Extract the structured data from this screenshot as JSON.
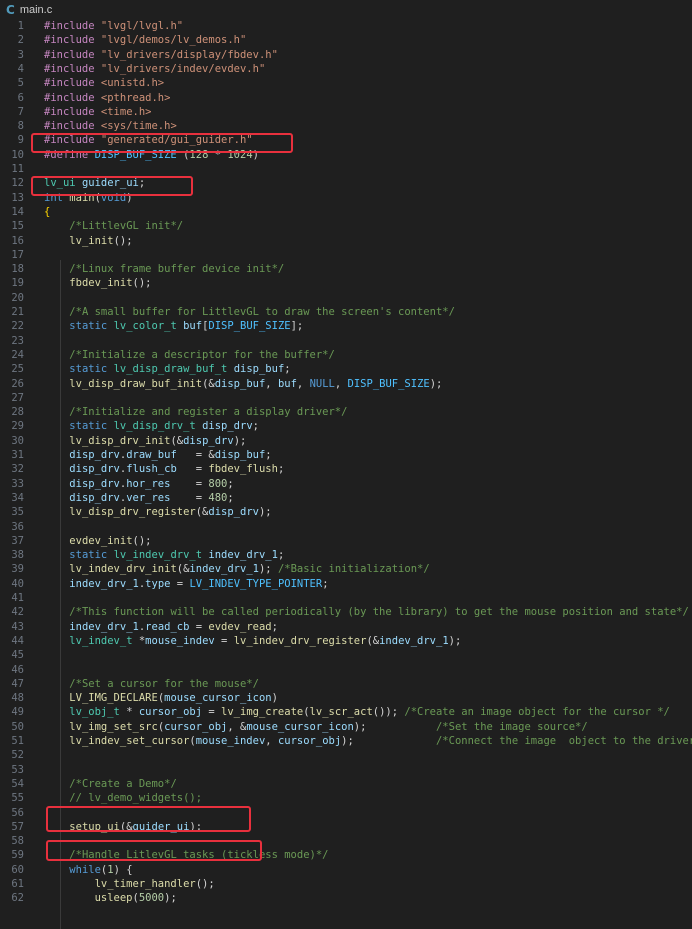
{
  "tab": {
    "icon": "C",
    "filename": "main.c"
  },
  "code": [
    {
      "n": "1",
      "t": [
        [
          "pp",
          "#include "
        ],
        [
          "str",
          "\"lvgl/lvgl.h\""
        ]
      ]
    },
    {
      "n": "2",
      "t": [
        [
          "pp",
          "#include "
        ],
        [
          "str",
          "\"lvgl/demos/lv_demos.h\""
        ]
      ]
    },
    {
      "n": "3",
      "t": [
        [
          "pp",
          "#include "
        ],
        [
          "str",
          "\"lv_drivers/display/fbdev.h\""
        ]
      ]
    },
    {
      "n": "4",
      "t": [
        [
          "pp",
          "#include "
        ],
        [
          "str",
          "\"lv_drivers/indev/evdev.h\""
        ]
      ]
    },
    {
      "n": "5",
      "t": [
        [
          "pp",
          "#include "
        ],
        [
          "str",
          "<unistd.h>"
        ]
      ]
    },
    {
      "n": "6",
      "t": [
        [
          "pp",
          "#include "
        ],
        [
          "str",
          "<pthread.h>"
        ]
      ]
    },
    {
      "n": "7",
      "t": [
        [
          "pp",
          "#include "
        ],
        [
          "str",
          "<time.h>"
        ]
      ]
    },
    {
      "n": "8",
      "t": [
        [
          "pp",
          "#include "
        ],
        [
          "str",
          "<sys/time.h>"
        ]
      ]
    },
    {
      "n": "9",
      "t": [
        [
          "pp",
          "#include "
        ],
        [
          "str",
          "\"generated/gui_guider.h\""
        ]
      ]
    },
    {
      "n": "10",
      "t": [
        [
          "pp",
          "#define "
        ],
        [
          "mc",
          "DISP_BUF_SIZE"
        ],
        [
          "pl",
          " ("
        ],
        [
          "nm",
          "128"
        ],
        [
          "pl",
          " * "
        ],
        [
          "nm",
          "1024"
        ],
        [
          "pl",
          ")"
        ]
      ]
    },
    {
      "n": "11",
      "t": []
    },
    {
      "n": "12",
      "t": [
        [
          "ty",
          "lv_ui"
        ],
        [
          "pl",
          " "
        ],
        [
          "vr",
          "guider_ui"
        ],
        [
          "pl",
          ";"
        ]
      ]
    },
    {
      "n": "13",
      "t": [
        [
          "kw",
          "int"
        ],
        [
          "pl",
          " "
        ],
        [
          "fn",
          "main"
        ],
        [
          "pl",
          "("
        ],
        [
          "kw",
          "void"
        ],
        [
          "pl",
          ")"
        ]
      ]
    },
    {
      "n": "14",
      "t": [
        [
          "br",
          "{"
        ]
      ]
    },
    {
      "n": "15",
      "t": [
        [
          "pl",
          "    "
        ],
        [
          "cm",
          "/*LittlevGL init*/"
        ]
      ]
    },
    {
      "n": "16",
      "t": [
        [
          "pl",
          "    "
        ],
        [
          "fn",
          "lv_init"
        ],
        [
          "pl",
          "();"
        ]
      ]
    },
    {
      "n": "17",
      "t": []
    },
    {
      "n": "18",
      "t": [
        [
          "pl",
          "    "
        ],
        [
          "cm",
          "/*Linux frame buffer device init*/"
        ]
      ]
    },
    {
      "n": "19",
      "t": [
        [
          "pl",
          "    "
        ],
        [
          "fn",
          "fbdev_init"
        ],
        [
          "pl",
          "();"
        ]
      ]
    },
    {
      "n": "20",
      "t": []
    },
    {
      "n": "21",
      "t": [
        [
          "pl",
          "    "
        ],
        [
          "cm",
          "/*A small buffer for LittlevGL to draw the screen's content*/"
        ]
      ]
    },
    {
      "n": "22",
      "t": [
        [
          "pl",
          "    "
        ],
        [
          "kw",
          "static"
        ],
        [
          "pl",
          " "
        ],
        [
          "ty",
          "lv_color_t"
        ],
        [
          "pl",
          " "
        ],
        [
          "vr",
          "buf"
        ],
        [
          "pl",
          "["
        ],
        [
          "mc",
          "DISP_BUF_SIZE"
        ],
        [
          "pl",
          "];"
        ]
      ]
    },
    {
      "n": "23",
      "t": []
    },
    {
      "n": "24",
      "t": [
        [
          "pl",
          "    "
        ],
        [
          "cm",
          "/*Initialize a descriptor for the buffer*/"
        ]
      ]
    },
    {
      "n": "25",
      "t": [
        [
          "pl",
          "    "
        ],
        [
          "kw",
          "static"
        ],
        [
          "pl",
          " "
        ],
        [
          "ty",
          "lv_disp_draw_buf_t"
        ],
        [
          "pl",
          " "
        ],
        [
          "vr",
          "disp_buf"
        ],
        [
          "pl",
          ";"
        ]
      ]
    },
    {
      "n": "26",
      "t": [
        [
          "pl",
          "    "
        ],
        [
          "fn",
          "lv_disp_draw_buf_init"
        ],
        [
          "pl",
          "(&"
        ],
        [
          "vr",
          "disp_buf"
        ],
        [
          "pl",
          ", "
        ],
        [
          "vr",
          "buf"
        ],
        [
          "pl",
          ", "
        ],
        [
          "kw",
          "NULL"
        ],
        [
          "pl",
          ", "
        ],
        [
          "mc",
          "DISP_BUF_SIZE"
        ],
        [
          "pl",
          ");"
        ]
      ]
    },
    {
      "n": "27",
      "t": []
    },
    {
      "n": "28",
      "t": [
        [
          "pl",
          "    "
        ],
        [
          "cm",
          "/*Initialize and register a display driver*/"
        ]
      ]
    },
    {
      "n": "29",
      "t": [
        [
          "pl",
          "    "
        ],
        [
          "kw",
          "static"
        ],
        [
          "pl",
          " "
        ],
        [
          "ty",
          "lv_disp_drv_t"
        ],
        [
          "pl",
          " "
        ],
        [
          "vr",
          "disp_drv"
        ],
        [
          "pl",
          ";"
        ]
      ]
    },
    {
      "n": "30",
      "t": [
        [
          "pl",
          "    "
        ],
        [
          "fn",
          "lv_disp_drv_init"
        ],
        [
          "pl",
          "(&"
        ],
        [
          "vr",
          "disp_drv"
        ],
        [
          "pl",
          ");"
        ]
      ]
    },
    {
      "n": "31",
      "t": [
        [
          "pl",
          "    "
        ],
        [
          "vr",
          "disp_drv"
        ],
        [
          "pl",
          "."
        ],
        [
          "vr",
          "draw_buf"
        ],
        [
          "pl",
          "   = &"
        ],
        [
          "vr",
          "disp_buf"
        ],
        [
          "pl",
          ";"
        ]
      ]
    },
    {
      "n": "32",
      "t": [
        [
          "pl",
          "    "
        ],
        [
          "vr",
          "disp_drv"
        ],
        [
          "pl",
          "."
        ],
        [
          "vr",
          "flush_cb"
        ],
        [
          "pl",
          "   = "
        ],
        [
          "fn",
          "fbdev_flush"
        ],
        [
          "pl",
          ";"
        ]
      ]
    },
    {
      "n": "33",
      "t": [
        [
          "pl",
          "    "
        ],
        [
          "vr",
          "disp_drv"
        ],
        [
          "pl",
          "."
        ],
        [
          "vr",
          "hor_res"
        ],
        [
          "pl",
          "    = "
        ],
        [
          "nm",
          "800"
        ],
        [
          "pl",
          ";"
        ]
      ]
    },
    {
      "n": "34",
      "t": [
        [
          "pl",
          "    "
        ],
        [
          "vr",
          "disp_drv"
        ],
        [
          "pl",
          "."
        ],
        [
          "vr",
          "ver_res"
        ],
        [
          "pl",
          "    = "
        ],
        [
          "nm",
          "480"
        ],
        [
          "pl",
          ";"
        ]
      ]
    },
    {
      "n": "35",
      "t": [
        [
          "pl",
          "    "
        ],
        [
          "fn",
          "lv_disp_drv_register"
        ],
        [
          "pl",
          "(&"
        ],
        [
          "vr",
          "disp_drv"
        ],
        [
          "pl",
          ");"
        ]
      ]
    },
    {
      "n": "36",
      "t": []
    },
    {
      "n": "37",
      "t": [
        [
          "pl",
          "    "
        ],
        [
          "fn",
          "evdev_init"
        ],
        [
          "pl",
          "();"
        ]
      ]
    },
    {
      "n": "38",
      "t": [
        [
          "pl",
          "    "
        ],
        [
          "kw",
          "static"
        ],
        [
          "pl",
          " "
        ],
        [
          "ty",
          "lv_indev_drv_t"
        ],
        [
          "pl",
          " "
        ],
        [
          "vr",
          "indev_drv_1"
        ],
        [
          "pl",
          ";"
        ]
      ]
    },
    {
      "n": "39",
      "t": [
        [
          "pl",
          "    "
        ],
        [
          "fn",
          "lv_indev_drv_init"
        ],
        [
          "pl",
          "(&"
        ],
        [
          "vr",
          "indev_drv_1"
        ],
        [
          "pl",
          "); "
        ],
        [
          "cm",
          "/*Basic initialization*/"
        ]
      ]
    },
    {
      "n": "40",
      "t": [
        [
          "pl",
          "    "
        ],
        [
          "vr",
          "indev_drv_1"
        ],
        [
          "pl",
          "."
        ],
        [
          "vr",
          "type"
        ],
        [
          "pl",
          " = "
        ],
        [
          "mc",
          "LV_INDEV_TYPE_POINTER"
        ],
        [
          "pl",
          ";"
        ]
      ]
    },
    {
      "n": "41",
      "t": []
    },
    {
      "n": "42",
      "t": [
        [
          "pl",
          "    "
        ],
        [
          "cm",
          "/*This function will be called periodically (by the library) to get the mouse position and state*/"
        ]
      ]
    },
    {
      "n": "43",
      "t": [
        [
          "pl",
          "    "
        ],
        [
          "vr",
          "indev_drv_1"
        ],
        [
          "pl",
          "."
        ],
        [
          "vr",
          "read_cb"
        ],
        [
          "pl",
          " = "
        ],
        [
          "fn",
          "evdev_read"
        ],
        [
          "pl",
          ";"
        ]
      ]
    },
    {
      "n": "44",
      "t": [
        [
          "pl",
          "    "
        ],
        [
          "ty",
          "lv_indev_t"
        ],
        [
          "pl",
          " *"
        ],
        [
          "vr",
          "mouse_indev"
        ],
        [
          "pl",
          " = "
        ],
        [
          "fn",
          "lv_indev_drv_register"
        ],
        [
          "pl",
          "(&"
        ],
        [
          "vr",
          "indev_drv_1"
        ],
        [
          "pl",
          ");"
        ]
      ]
    },
    {
      "n": "45",
      "t": []
    },
    {
      "n": "46",
      "t": []
    },
    {
      "n": "47",
      "t": [
        [
          "pl",
          "    "
        ],
        [
          "cm",
          "/*Set a cursor for the mouse*/"
        ]
      ]
    },
    {
      "n": "48",
      "t": [
        [
          "pl",
          "    "
        ],
        [
          "fn",
          "LV_IMG_DECLARE"
        ],
        [
          "pl",
          "("
        ],
        [
          "vr",
          "mouse_cursor_icon"
        ],
        [
          "pl",
          ")"
        ]
      ]
    },
    {
      "n": "49",
      "t": [
        [
          "pl",
          "    "
        ],
        [
          "ty",
          "lv_obj_t"
        ],
        [
          "pl",
          " * "
        ],
        [
          "vr",
          "cursor_obj"
        ],
        [
          "pl",
          " = "
        ],
        [
          "fn",
          "lv_img_create"
        ],
        [
          "pl",
          "("
        ],
        [
          "fn",
          "lv_scr_act"
        ],
        [
          "pl",
          "()); "
        ],
        [
          "cm",
          "/*Create an image object for the cursor */"
        ]
      ]
    },
    {
      "n": "50",
      "t": [
        [
          "pl",
          "    "
        ],
        [
          "fn",
          "lv_img_set_src"
        ],
        [
          "pl",
          "("
        ],
        [
          "vr",
          "cursor_obj"
        ],
        [
          "pl",
          ", &"
        ],
        [
          "vr",
          "mouse_cursor_icon"
        ],
        [
          "pl",
          ");           "
        ],
        [
          "cm",
          "/*Set the image source*/"
        ]
      ]
    },
    {
      "n": "51",
      "t": [
        [
          "pl",
          "    "
        ],
        [
          "fn",
          "lv_indev_set_cursor"
        ],
        [
          "pl",
          "("
        ],
        [
          "vr",
          "mouse_indev"
        ],
        [
          "pl",
          ", "
        ],
        [
          "vr",
          "cursor_obj"
        ],
        [
          "pl",
          ");             "
        ],
        [
          "cm",
          "/*Connect the image  object to the driver*/"
        ]
      ]
    },
    {
      "n": "52",
      "t": []
    },
    {
      "n": "53",
      "t": []
    },
    {
      "n": "54",
      "t": [
        [
          "pl",
          "    "
        ],
        [
          "cm",
          "/*Create a Demo*/"
        ]
      ]
    },
    {
      "n": "55",
      "t": [
        [
          "pl",
          "    "
        ],
        [
          "cm",
          "// lv_demo_widgets();"
        ]
      ]
    },
    {
      "n": "56",
      "t": []
    },
    {
      "n": "57",
      "t": [
        [
          "pl",
          "    "
        ],
        [
          "fn",
          "setup_ui"
        ],
        [
          "pl",
          "(&"
        ],
        [
          "vr",
          "guider_ui"
        ],
        [
          "pl",
          ");"
        ]
      ]
    },
    {
      "n": "58",
      "t": []
    },
    {
      "n": "59",
      "t": [
        [
          "pl",
          "    "
        ],
        [
          "cm",
          "/*Handle LitlevGL tasks (tickless mode)*/"
        ]
      ]
    },
    {
      "n": "60",
      "t": [
        [
          "pl",
          "    "
        ],
        [
          "kw",
          "while"
        ],
        [
          "pl",
          "("
        ],
        [
          "nm",
          "1"
        ],
        [
          "pl",
          ") {"
        ]
      ]
    },
    {
      "n": "61",
      "t": [
        [
          "pl",
          "        "
        ],
        [
          "fn",
          "lv_timer_handler"
        ],
        [
          "pl",
          "();"
        ]
      ]
    },
    {
      "n": "62",
      "t": [
        [
          "pl",
          "        "
        ],
        [
          "fn",
          "usleep"
        ],
        [
          "pl",
          "("
        ],
        [
          "nm",
          "5000"
        ],
        [
          "pl",
          ");"
        ]
      ]
    }
  ],
  "highlight_color": "#e8303d"
}
